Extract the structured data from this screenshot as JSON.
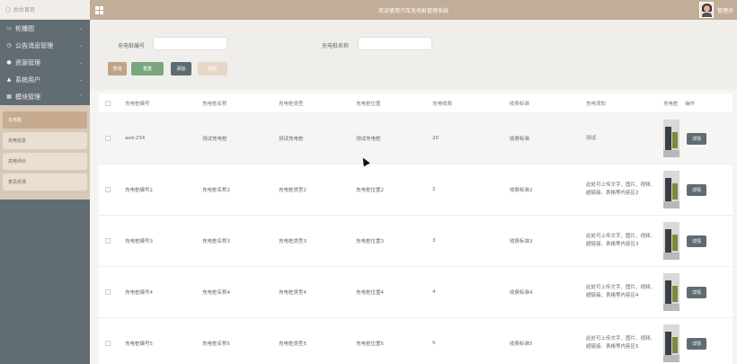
{
  "header": {
    "home_label": "后台首页",
    "site_title": "欢迎使用汽车充电桩管理系统",
    "user_label": "管理员"
  },
  "sidebar": {
    "items": [
      {
        "label": "轮播图",
        "icon": "image-icon"
      },
      {
        "label": "公告消息管理",
        "icon": "clock-icon"
      },
      {
        "label": "资源管理",
        "icon": "location-icon"
      },
      {
        "label": "系统用户",
        "icon": "user-icon"
      },
      {
        "label": "模块管理",
        "icon": "grid-icon"
      }
    ],
    "sub_items": [
      {
        "label": "充电桩",
        "active": true
      },
      {
        "label": "充电信息",
        "active": false
      },
      {
        "label": "充电评价",
        "active": false
      },
      {
        "label": "意见反馈",
        "active": false
      }
    ]
  },
  "search": {
    "field1_label": "充电桩编号",
    "field1_value": "",
    "field2_label": "充电桩名称",
    "field2_value": "",
    "buttons": {
      "query": "查询",
      "reset": "重置",
      "add": "添加",
      "delete": "删除"
    }
  },
  "table": {
    "headers": [
      "充电桩编号",
      "充电桩名称",
      "充电桩类型",
      "充电桩位置",
      "充电收费",
      "收费标准",
      "充电须知",
      "充电桩图片",
      "操作"
    ],
    "header_img_short": "充电桩",
    "detail_label": "详情",
    "rows": [
      {
        "no": "asd-234",
        "name": "测试充电桩",
        "type": "测试充电桩",
        "loc": "测试充电桩",
        "fee": "20",
        "std": "收费标准",
        "note": "测试"
      },
      {
        "no": "充电桩编号2",
        "name": "充电桩名称2",
        "type": "充电桩类型2",
        "loc": "充电桩位置2",
        "fee": "2",
        "std": "收费标准2",
        "note": "此处可上传文字、图片、视频、超链接、表格等内容区2"
      },
      {
        "no": "充电桩编号3",
        "name": "充电桩名称3",
        "type": "充电桩类型3",
        "loc": "充电桩位置3",
        "fee": "3",
        "std": "收费标准3",
        "note": "此处可上传文字、图片、视频、超链接、表格等内容区3"
      },
      {
        "no": "充电桩编号4",
        "name": "充电桩名称4",
        "type": "充电桩类型4",
        "loc": "充电桩位置4",
        "fee": "4",
        "std": "收费标准4",
        "note": "此处可上传文字、图片、视频、超链接、表格等内容区4"
      },
      {
        "no": "充电桩编号5",
        "name": "充电桩名称5",
        "type": "充电桩类型5",
        "loc": "充电桩位置5",
        "fee": "5",
        "std": "收费标准5",
        "note": "此处可上传文字、图片、视频、超链接、表格等内容区5"
      }
    ]
  },
  "colors": {
    "topbar": "#c2ad98",
    "sidebar": "#626d73",
    "query_btn": "#c0a487",
    "reset_btn": "#79a87f",
    "add_btn": "#5e6b72",
    "delete_btn": "#e6d7c6"
  }
}
